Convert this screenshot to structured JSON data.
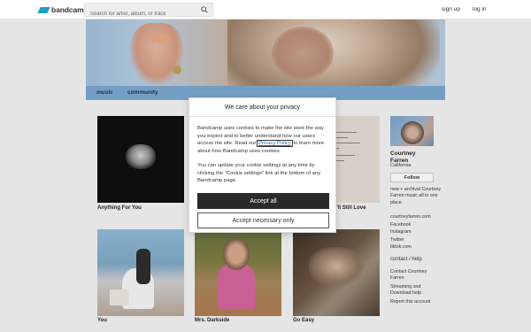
{
  "header": {
    "logo_text": "bandcamp",
    "search_placeholder": "Search for artist, album, or track",
    "signup": "sign up",
    "login": "log in"
  },
  "band_nav": {
    "music": "music",
    "community": "community"
  },
  "albums": [
    {
      "title": "Anything For You"
    },
    {
      "title": "ou'll Still Love"
    },
    {
      "title": "You"
    },
    {
      "title": "Mrs. Darkside"
    },
    {
      "title": "Go Easy"
    }
  ],
  "sidebar": {
    "name": "Courtney Farren",
    "location": "California",
    "follow": "Follow",
    "bio": "new + archival Courtney Farren music all in one place",
    "links": [
      "courtneyfarren.com",
      "Facebook",
      "Instagram",
      "Twitter",
      "tiktok.com"
    ],
    "contact_heading": "contact / help",
    "contact_links": [
      "Contact Courtney Farren",
      "Streaming and Download help"
    ],
    "report": "Report this account"
  },
  "cookie_modal": {
    "title": "We care about your privacy",
    "p1_before": "Bandcamp uses cookies to make the site work the way you expect and to better understand how our users access the site. Read our ",
    "privacy_link": "Privacy Policy",
    "p1_after": " to learn more about how Bandcamp uses cookies.",
    "p2": "You can update your cookie settings at any time by clicking the “Cookie settings” link at the bottom of any Bandcamp page.",
    "accept_all": "Accept all",
    "accept_necessary": "Accept necessary only"
  },
  "colors": {
    "brand": "#1da0c3",
    "band_nav_bg": "#7aa6d1",
    "primary_button": "#2a2a2a"
  }
}
